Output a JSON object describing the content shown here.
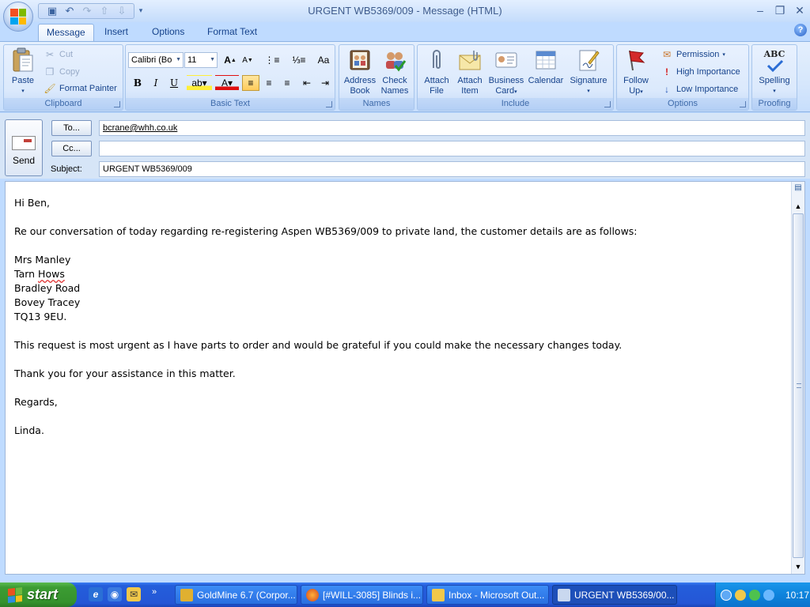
{
  "window": {
    "title": "URGENT WB5369/009 - Message (HTML)",
    "controls": {
      "minimize": "–",
      "maximize": "❐",
      "close": "✕"
    }
  },
  "ribbon_tabs": [
    "Message",
    "Insert",
    "Options",
    "Format Text"
  ],
  "clipboard": {
    "paste": "Paste",
    "cut": "Cut",
    "copy": "Copy",
    "format_painter": "Format Painter",
    "label": "Clipboard"
  },
  "basic_text": {
    "font": "Calibri (Bo",
    "size": "11",
    "bold": "B",
    "italic": "I",
    "underline": "U",
    "label": "Basic Text"
  },
  "names": {
    "address_book": [
      "Address",
      "Book"
    ],
    "check_names": [
      "Check",
      "Names"
    ],
    "label": "Names"
  },
  "include": {
    "attach_file": [
      "Attach",
      "File"
    ],
    "attach_item": [
      "Attach",
      "Item"
    ],
    "business_card": [
      "Business",
      "Card"
    ],
    "calendar": "Calendar",
    "signature": "Signature",
    "label": "Include"
  },
  "options": {
    "follow_up": [
      "Follow",
      "Up"
    ],
    "permission": "Permission",
    "high_importance": "High Importance",
    "low_importance": "Low Importance",
    "label": "Options"
  },
  "proofing": {
    "spelling_icon_text": "ABC",
    "spelling": "Spelling",
    "label": "Proofing"
  },
  "header": {
    "send": "Send",
    "to_button": "To...",
    "cc_button": "Cc...",
    "subject_label": "Subject:",
    "to_value": "bcrane@whh.co.uk",
    "cc_value": "",
    "subject_value": "URGENT WB5369/009"
  },
  "body": {
    "greeting": "Hi Ben,",
    "intro": "Re our conversation of today regarding re-registering Aspen WB5369/009 to private land, the customer details are as follows:",
    "address": {
      "name": "Mrs Manley",
      "line1_a": "Tarn ",
      "line1_b": "Hows",
      "line2": "Bradley Road",
      "line3": "Bovey Tracey",
      "postcode": "TQ13 9EU."
    },
    "request": "This request is most urgent as I have parts to order and would be grateful if you could make the necessary changes today.",
    "thanks": "Thank you for your assistance in this matter.",
    "signoff": "Regards,",
    "signature": "Linda."
  },
  "taskbar": {
    "start": "start",
    "more": "»",
    "tasks": [
      "GoldMine 6.7 (Corpor...",
      "[#WILL-3085] Blinds i...",
      "Inbox - Microsoft Out...",
      "URGENT WB5369/00..."
    ],
    "clock": "10:17"
  }
}
